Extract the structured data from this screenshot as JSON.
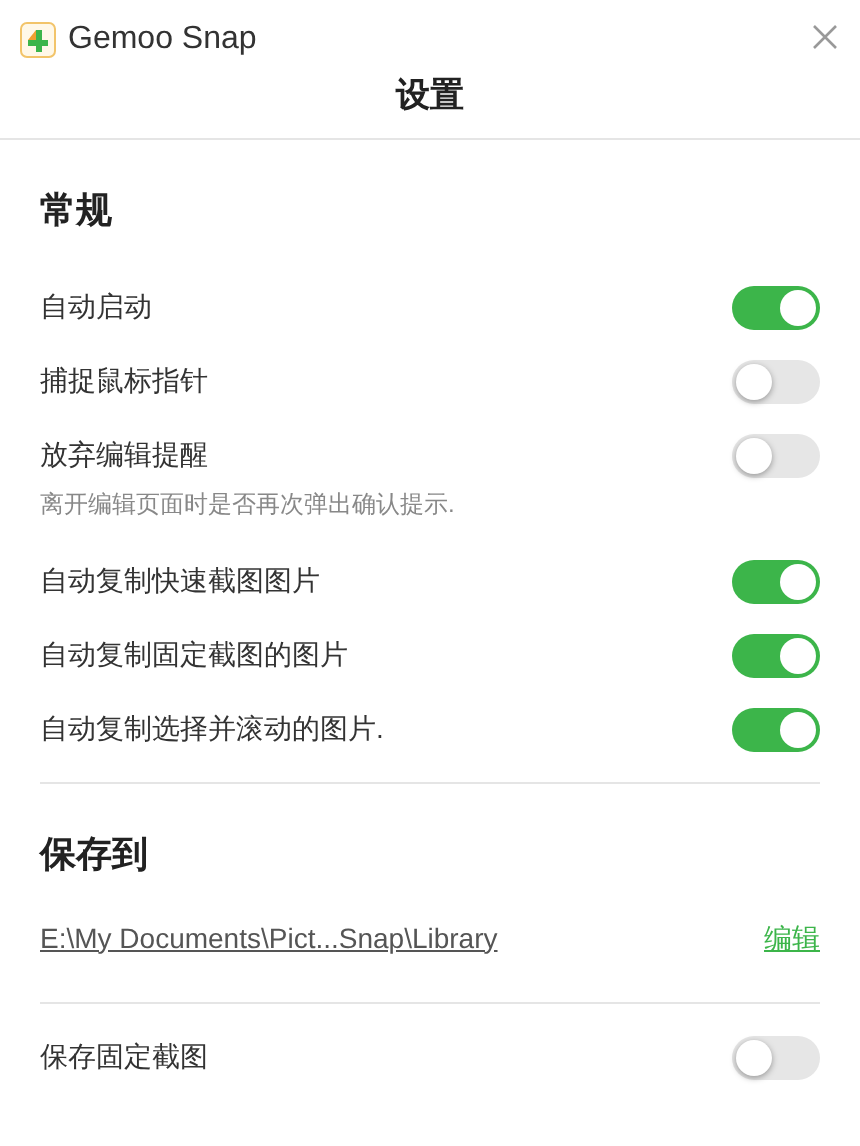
{
  "window": {
    "title": "Gemoo Snap",
    "heading": "设置"
  },
  "general": {
    "title": "常规",
    "items": [
      {
        "label": "自动启动",
        "on": true
      },
      {
        "label": "捕捉鼠标指针",
        "on": false
      },
      {
        "label": "放弃编辑提醒",
        "on": false,
        "hint": "离开编辑页面时是否再次弹出确认提示."
      },
      {
        "label": "自动复制快速截图图片",
        "on": true
      },
      {
        "label": "自动复制固定截图的图片",
        "on": true
      },
      {
        "label": "自动复制选择并滚动的图片.",
        "on": true
      }
    ]
  },
  "save_to": {
    "title": "保存到",
    "path": "E:\\My Documents\\Pict...Snap\\Library",
    "edit_link": "编辑",
    "items": [
      {
        "label": "保存固定截图",
        "on": false
      }
    ]
  }
}
